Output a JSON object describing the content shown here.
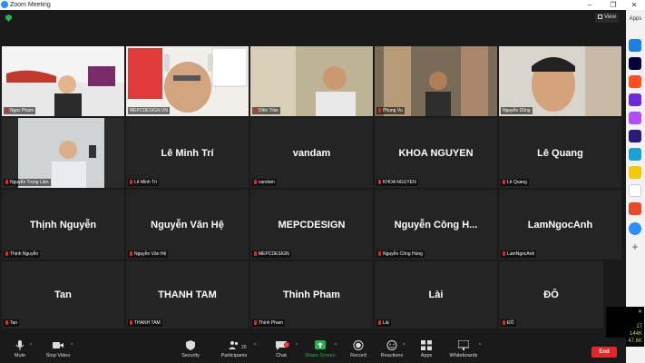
{
  "window": {
    "title": "Zoom Meeting",
    "controls": [
      "minimize-icon",
      "restore-icon",
      "close-icon"
    ]
  },
  "top": {
    "view_label": "View",
    "security_icon": "shield-check-icon"
  },
  "sidebar": {
    "label": "Apps",
    "apps": [
      "zoom-apps-icon",
      "miro-icon",
      "mural-icon",
      "workvivo-icon",
      "game-icon",
      "wrike-icon",
      "slack-icon",
      "smile-icon",
      "twine-icon",
      "app-icon",
      "refresh-icon"
    ]
  },
  "tiles": [
    {
      "name": "Ngoc Pham",
      "type": "video"
    },
    {
      "name": "MEPCDESIGN.VN",
      "type": "video",
      "active": true
    },
    {
      "name": "Diên Trần",
      "type": "video"
    },
    {
      "name": "Phung Vu",
      "type": "video"
    },
    {
      "name": "Nguyễn Dũng",
      "type": "video"
    },
    {
      "name": "Nguyễn Trọng Lâm",
      "type": "video"
    },
    {
      "name": "Lê Minh Trí",
      "type": "name"
    },
    {
      "name": "vandam",
      "type": "name"
    },
    {
      "name": "KHOA NGUYEN",
      "type": "name"
    },
    {
      "name": "Lê Quang",
      "type": "name"
    },
    {
      "name": "Thịnh Nguyễn",
      "type": "name"
    },
    {
      "name": "Nguyễn Văn Hệ",
      "type": "name"
    },
    {
      "name": "MEPCDESIGN",
      "type": "name"
    },
    {
      "name": "Nguyễn Công Hùng",
      "display": "Nguyễn Công H...",
      "type": "name"
    },
    {
      "name": "LamNgocAnh",
      "type": "name"
    },
    {
      "name": "Tan",
      "type": "name"
    },
    {
      "name": "THANH TAM",
      "type": "name"
    },
    {
      "name": "Thinh Pham",
      "type": "name"
    },
    {
      "name": "Lài",
      "type": "name"
    },
    {
      "name": "ĐÔ",
      "type": "name"
    }
  ],
  "toolbar": {
    "mute": "Mute",
    "stop_video": "Stop Video",
    "security": "Security",
    "participants": "Participants",
    "participants_count": "20",
    "chat": "Chat",
    "chat_badge": "1",
    "share_screen": "Share Screen",
    "record": "Record",
    "reactions": "Reactions",
    "apps": "Apps",
    "whiteboards": "Whiteboards",
    "end": "End"
  },
  "stats": {
    "close": "✕",
    "fps": "17",
    "rate1": "144K",
    "rate2": "47.6K"
  },
  "colors": {
    "active_speaker": "#d6e03a",
    "share_green": "#25b44a",
    "end_red": "#e02828",
    "zoom_blue": "#2d8cff"
  }
}
